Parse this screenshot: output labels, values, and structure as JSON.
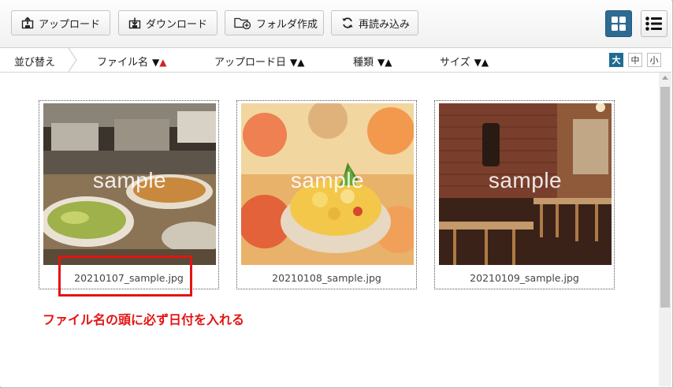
{
  "toolbar": {
    "upload_label": "アップロード",
    "download_label": "ダウンロード",
    "new_folder_label": "フォルダ作成",
    "reload_label": "再読み込み"
  },
  "view_toggle": {
    "grid_icon": "grid-icon",
    "list_icon": "list-icon",
    "active": "grid"
  },
  "sort_bar": {
    "label": "並び替え",
    "columns": [
      {
        "label": "ファイル名",
        "down": "▼",
        "up": "▲"
      },
      {
        "label": "アップロード日",
        "down": "▼",
        "up": "▲"
      },
      {
        "label": "種類",
        "down": "▼",
        "up": "▲"
      },
      {
        "label": "サイズ",
        "down": "▼",
        "up": "▲"
      }
    ],
    "active_color": "#d42222"
  },
  "thumb_size": {
    "large": "大",
    "medium": "中",
    "small": "小",
    "active": "large"
  },
  "files": [
    {
      "name": "20210107_sample.jpg",
      "watermark": "sample"
    },
    {
      "name": "20210108_sample.jpg",
      "watermark": "sample"
    },
    {
      "name": "20210109_sample.jpg",
      "watermark": "sample"
    }
  ],
  "annotation": {
    "note": "ファイル名の頭に必ず日付を入れる",
    "color": "#e41414"
  }
}
